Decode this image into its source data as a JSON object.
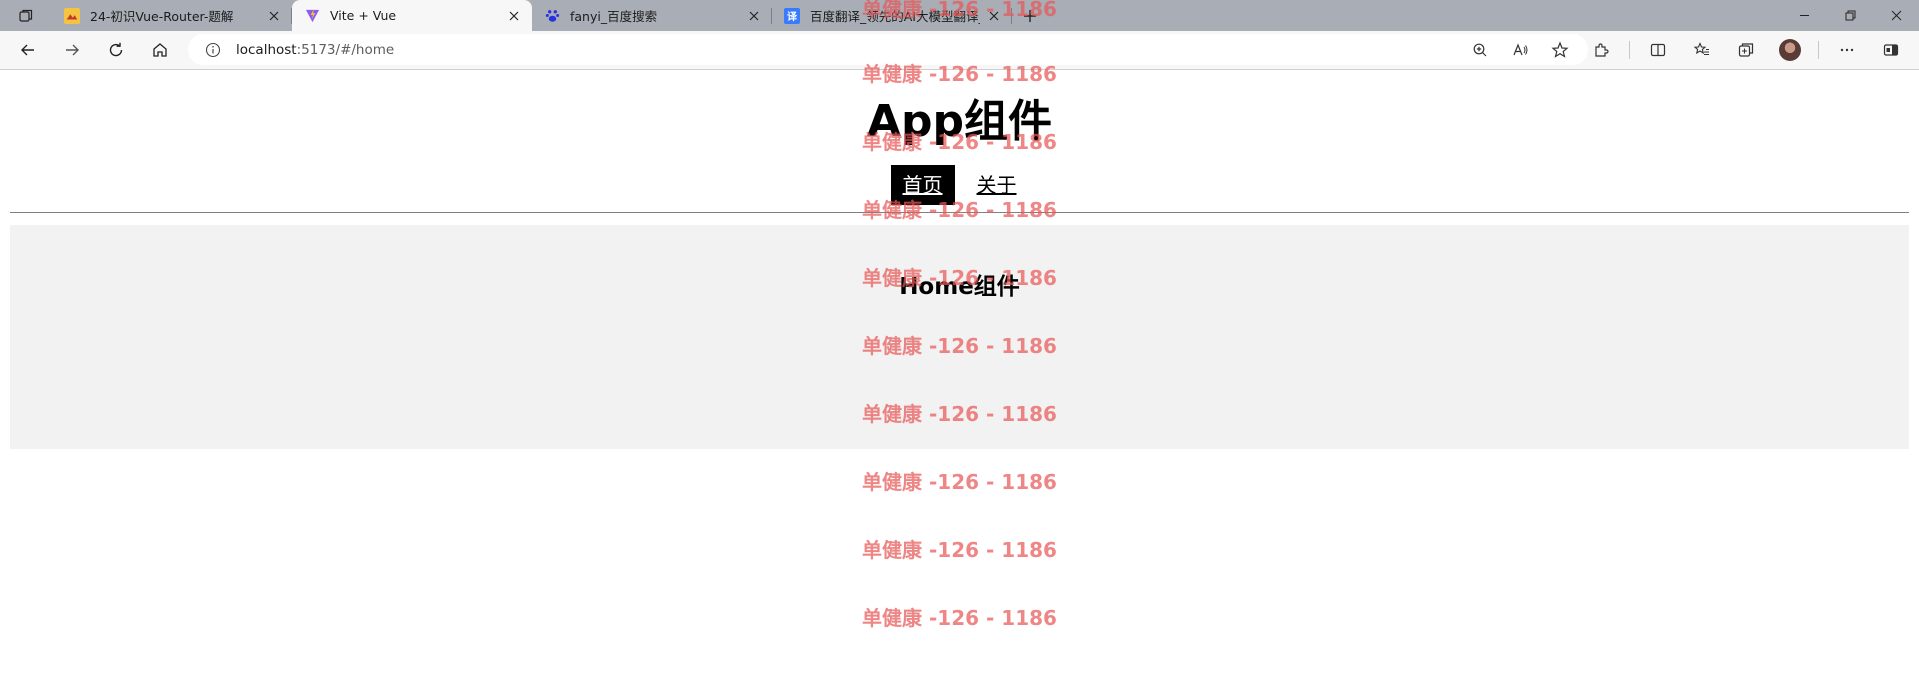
{
  "browser": {
    "tabs": [
      {
        "title": "24-初识Vue-Router-题解",
        "favicon": "article-icon",
        "active": false
      },
      {
        "title": "Vite + Vue",
        "favicon": "vite-icon",
        "active": true
      },
      {
        "title": "fanyi_百度搜索",
        "favicon": "baidu-paw-icon",
        "active": false
      },
      {
        "title": "百度翻译_领先的AI大模型翻译_文",
        "favicon": "translate-icon",
        "active": false
      }
    ],
    "address": {
      "host": "localhost",
      "path": ":5173/#/home"
    },
    "colors": {
      "tabstrip": "#a9aeb6",
      "toolbar": "#f7f7f7"
    }
  },
  "app": {
    "title": "App组件",
    "nav": [
      {
        "label": "首页",
        "active": true
      },
      {
        "label": "关于",
        "active": false
      }
    ],
    "home": {
      "title": "Home组件"
    },
    "colors": {
      "nav_active_bg": "#000000",
      "home_bg": "#f2f2f2"
    }
  },
  "watermark": {
    "text": "单健康 -126 - 1186",
    "color": "#e85858"
  }
}
